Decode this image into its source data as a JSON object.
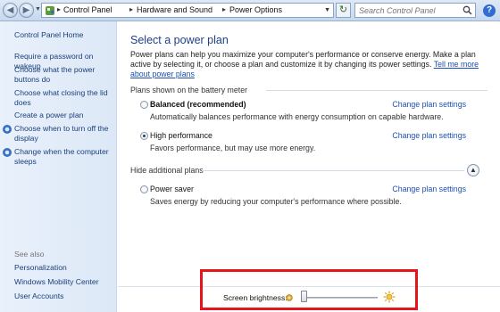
{
  "toolbar": {
    "back_glyph": "◀",
    "forward_glyph": "▶",
    "refresh_glyph": "↻",
    "breadcrumb": [
      "Control Panel",
      "Hardware and Sound",
      "Power Options"
    ],
    "search_placeholder": "Search Control Panel",
    "help_glyph": "?"
  },
  "sidebar": {
    "home": "Control Panel Home",
    "items": [
      "Require a password on wakeup",
      "Choose what the power buttons do",
      "Choose what closing the lid does",
      "Create a power plan",
      "Choose when to turn off the display",
      "Change when the computer sleeps"
    ],
    "see_also_heading": "See also",
    "see_also": [
      "Personalization",
      "Windows Mobility Center",
      "User Accounts"
    ]
  },
  "main": {
    "title": "Select a power plan",
    "intro": "Power plans can help you maximize your computer's performance or conserve energy. Make a plan active by selecting it, or choose a plan and customize it by changing its power settings.",
    "intro_link": "Tell me more about power plans",
    "battery_group": "Plans shown on the battery meter",
    "plans": [
      {
        "name": "Balanced (recommended)",
        "desc": "Automatically balances performance with energy consumption on capable hardware.",
        "selected": false,
        "link": "Change plan settings"
      },
      {
        "name": "High performance",
        "desc": "Favors performance, but may use more energy.",
        "selected": true,
        "link": "Change plan settings"
      }
    ],
    "hidden_group": "Hide additional plans",
    "hidden_plans": [
      {
        "name": "Power saver",
        "desc": "Saves energy by reducing your computer's performance where possible.",
        "selected": false,
        "link": "Change plan settings"
      }
    ],
    "brightness_label": "Screen brightness:",
    "brightness_level": 0.0
  },
  "colors": {
    "accent": "#1f3f8c",
    "link": "#1c4fb3",
    "highlight": "#e8141c"
  }
}
